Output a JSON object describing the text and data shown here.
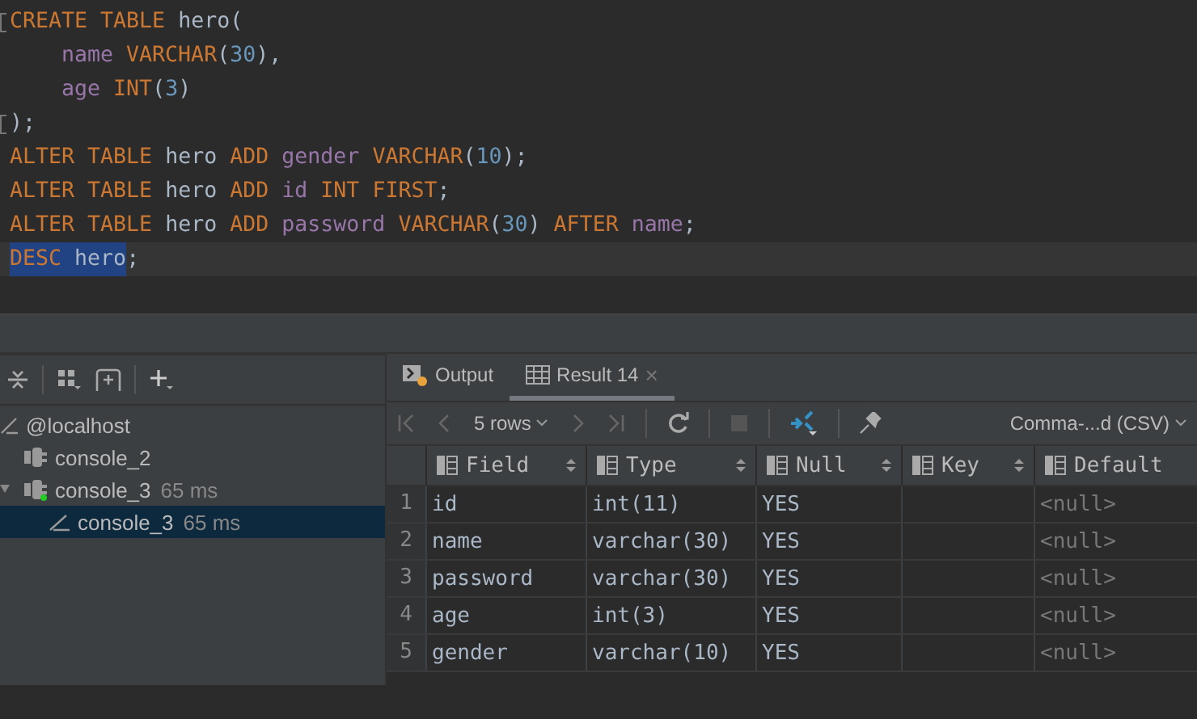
{
  "editor": {
    "lines": [
      {
        "indent": false,
        "fold": true,
        "tokens": [
          {
            "text": "CREATE TABLE ",
            "kind": "keyword"
          },
          {
            "text": "hero(",
            "kind": "ident"
          }
        ]
      },
      {
        "indent": true,
        "fold": false,
        "tokens": [
          {
            "text": "name ",
            "kind": "column"
          },
          {
            "text": "VARCHAR",
            "kind": "keyword"
          },
          {
            "text": "(",
            "kind": "ident"
          },
          {
            "text": "30",
            "kind": "number"
          },
          {
            "text": "),",
            "kind": "ident"
          }
        ]
      },
      {
        "indent": true,
        "fold": false,
        "tokens": [
          {
            "text": "age ",
            "kind": "column"
          },
          {
            "text": "INT",
            "kind": "keyword"
          },
          {
            "text": "(",
            "kind": "ident"
          },
          {
            "text": "3",
            "kind": "number"
          },
          {
            "text": ")",
            "kind": "ident"
          }
        ]
      },
      {
        "indent": false,
        "fold": true,
        "tokens": [
          {
            "text": ");",
            "kind": "ident"
          }
        ]
      },
      {
        "indent": false,
        "fold": false,
        "tokens": [
          {
            "text": "ALTER TABLE ",
            "kind": "keyword"
          },
          {
            "text": "hero ",
            "kind": "ident"
          },
          {
            "text": "ADD ",
            "kind": "keyword"
          },
          {
            "text": "gender ",
            "kind": "column"
          },
          {
            "text": "VARCHAR",
            "kind": "keyword"
          },
          {
            "text": "(",
            "kind": "ident"
          },
          {
            "text": "10",
            "kind": "number"
          },
          {
            "text": ");",
            "kind": "ident"
          }
        ]
      },
      {
        "indent": false,
        "fold": false,
        "tokens": [
          {
            "text": "ALTER TABLE ",
            "kind": "keyword"
          },
          {
            "text": "hero ",
            "kind": "ident"
          },
          {
            "text": "ADD ",
            "kind": "keyword"
          },
          {
            "text": "id ",
            "kind": "column"
          },
          {
            "text": "INT FIRST",
            "kind": "keyword"
          },
          {
            "text": ";",
            "kind": "ident"
          }
        ]
      },
      {
        "indent": false,
        "fold": false,
        "tokens": [
          {
            "text": "ALTER TABLE ",
            "kind": "keyword"
          },
          {
            "text": "hero ",
            "kind": "ident"
          },
          {
            "text": "ADD ",
            "kind": "keyword"
          },
          {
            "text": "password ",
            "kind": "column"
          },
          {
            "text": "VARCHAR",
            "kind": "keyword"
          },
          {
            "text": "(",
            "kind": "ident"
          },
          {
            "text": "30",
            "kind": "number"
          },
          {
            "text": ") ",
            "kind": "ident"
          },
          {
            "text": "AFTER ",
            "kind": "keyword"
          },
          {
            "text": "name",
            "kind": "column"
          },
          {
            "text": ";",
            "kind": "ident"
          }
        ]
      },
      {
        "indent": false,
        "fold": false,
        "tokens": [
          {
            "text": "DESC ",
            "kind": "keyword",
            "selected": true
          },
          {
            "text": "hero",
            "kind": "ident",
            "selected": true
          },
          {
            "text": ";",
            "kind": "ident",
            "selected": false
          }
        ]
      }
    ]
  },
  "services": {
    "tree": [
      {
        "label": "@localhost",
        "kind": "host",
        "selected": false,
        "expanded": true,
        "children": [
          {
            "label": "console_2",
            "kind": "console",
            "selected": false,
            "active": false,
            "expanded": false
          },
          {
            "label": "console_3",
            "time": "65 ms",
            "kind": "console",
            "selected": false,
            "active": true,
            "expanded": true,
            "children": [
              {
                "label": "console_3",
                "time": "65 ms",
                "kind": "session",
                "selected": true
              }
            ]
          }
        ]
      }
    ]
  },
  "results": {
    "tabs": [
      {
        "label": "Output",
        "kind": "output",
        "selected": false
      },
      {
        "label": "Result 14",
        "kind": "result",
        "selected": true,
        "close": "×"
      }
    ],
    "rows_selector": "5 rows",
    "export_format": "Comma-...d (CSV)",
    "table": {
      "columns": [
        "Field",
        "Type",
        "Null",
        "Key",
        "Default"
      ],
      "rows": [
        {
          "number": "1",
          "cells": [
            "id",
            "int(11)",
            "YES",
            "",
            "<null>"
          ]
        },
        {
          "number": "2",
          "cells": [
            "name",
            "varchar(30)",
            "YES",
            "",
            "<null>"
          ]
        },
        {
          "number": "3",
          "cells": [
            "password",
            "varchar(30)",
            "YES",
            "",
            "<null>"
          ]
        },
        {
          "number": "4",
          "cells": [
            "age",
            "int(3)",
            "YES",
            "",
            "<null>"
          ]
        },
        {
          "number": "5",
          "cells": [
            "gender",
            "varchar(10)",
            "YES",
            "",
            "<null>"
          ]
        }
      ]
    }
  }
}
